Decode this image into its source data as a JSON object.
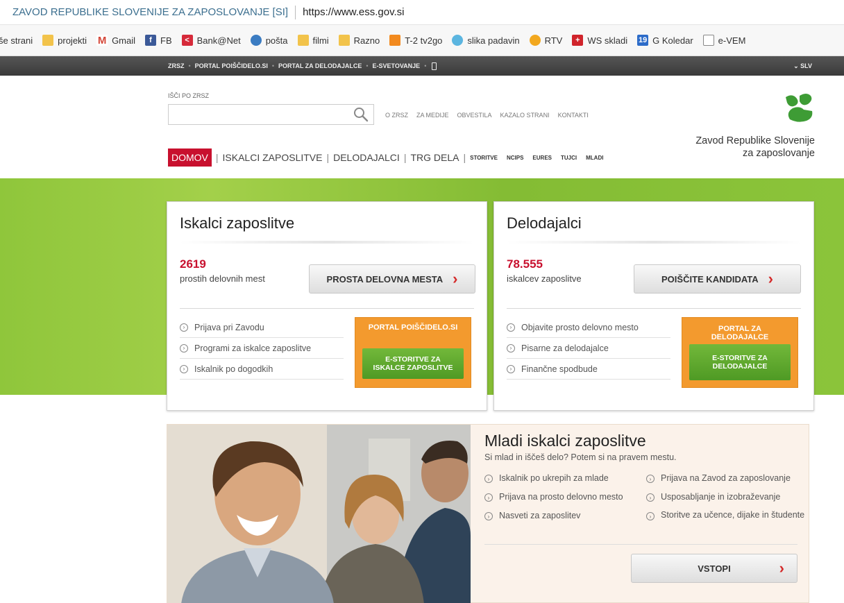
{
  "window": {
    "title": "ZAVOD REPUBLIKE SLOVENIJE ZA ZAPOSLOVANJE [SI]",
    "url": "https://www.ess.gov.si"
  },
  "bookmarks": [
    {
      "label": "še strani",
      "icon": ""
    },
    {
      "label": "projekti",
      "icon": "folder-icon"
    },
    {
      "label": "Gmail",
      "icon": "gmail-icon"
    },
    {
      "label": "FB",
      "icon": "facebook-icon"
    },
    {
      "label": "Bank@Net",
      "icon": "bank-icon"
    },
    {
      "label": "pošta",
      "icon": "mail-icon"
    },
    {
      "label": "filmi",
      "icon": "folder-icon"
    },
    {
      "label": "Razno",
      "icon": "folder-icon"
    },
    {
      "label": "T-2 tv2go",
      "icon": "tv-icon"
    },
    {
      "label": "slika padavin",
      "icon": "rain-icon"
    },
    {
      "label": "RTV",
      "icon": "rtv-icon"
    },
    {
      "label": "WS skladi",
      "icon": "ws-icon"
    },
    {
      "label": "G Koledar",
      "icon": "calendar-icon"
    },
    {
      "label": "e-VEM",
      "icon": "document-icon"
    }
  ],
  "topbar": {
    "links": [
      "ZRSZ",
      "PORTAL POIŠČIDELO.SI",
      "PORTAL ZA DELODAJALCE",
      "E-SVETOVANJE"
    ],
    "language": "⌄ SLV"
  },
  "header": {
    "search_label": "IŠČI PO ZRSZ",
    "search_value": "",
    "utility_links": [
      "O ZRSZ",
      "ZA MEDIJE",
      "OBVESTILA",
      "KAZALO STRANI",
      "KONTAKTI"
    ],
    "nav_active": "DOMOV",
    "nav_main": [
      "ISKALCI ZAPOSLITVE",
      "DELODAJALCI",
      "TRG DELA"
    ],
    "nav_small": [
      "STORITVE",
      "NCIPS",
      "EURES",
      "TUJCI",
      "MLADI"
    ],
    "logo_line1": "Zavod Republike Slovenije",
    "logo_line2": "za zaposlovanje"
  },
  "seekers": {
    "title": "Iskalci zaposlitve",
    "count": "2619",
    "count_label": "prostih delovnih mest",
    "button": "PROSTA DELOVNA MESTA",
    "links": [
      "Prijava pri Zavodu",
      "Programi za iskalce zaposlitve",
      "Iskalnik po dogodkih"
    ],
    "portal_title": "PORTAL POIŠČIDELO.SI",
    "portal_button_line1": "E-STORITVE ZA",
    "portal_button_line2": "ISKALCE ZAPOSLITVE"
  },
  "employers": {
    "title": "Delodajalci",
    "count": "78.555",
    "count_label": "iskalcev zaposlitve",
    "button": "POIŠČITE KANDIDATA",
    "links": [
      "Objavite prosto delovno mesto",
      "Pisarne za delodajalce",
      "Finančne spodbude"
    ],
    "portal_title_line1": "PORTAL ZA",
    "portal_title_line2": "DELODAJALCE",
    "portal_button_line1": "E-STORITVE ZA",
    "portal_button_line2": "DELODAJALCE"
  },
  "youth": {
    "title": "Mladi iskalci zaposlitve",
    "subtitle": "Si mlad in iščeš delo? Potem si na pravem mestu.",
    "links_left": [
      "Iskalnik po ukrepih za mlade",
      "Prijava na prosto delovno mesto",
      "Nasveti za zaposlitev"
    ],
    "links_right": [
      "Prijava na Zavod za zaposlovanje",
      "Usposabljanje in izobraževanje",
      "Storitve za učence, dijake in študente"
    ],
    "button": "VSTOPI"
  },
  "colors": {
    "accent_red": "#c8102e",
    "green_band": "#8fc63b",
    "orange_box": "#f39a2e",
    "green_button": "#5ea82c"
  }
}
